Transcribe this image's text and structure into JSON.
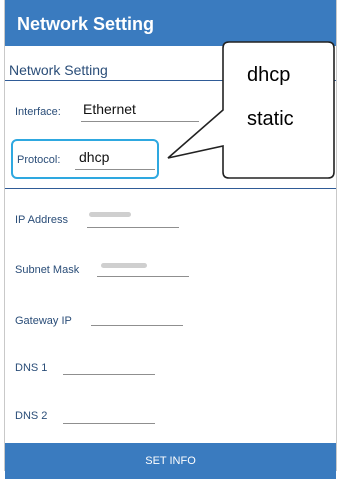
{
  "app": {
    "title": "Network Setting"
  },
  "section": {
    "title": "Network Setting"
  },
  "fields": {
    "interface": {
      "label": "Interface:",
      "value": "Ethernet"
    },
    "protocol": {
      "label": "Protocol:",
      "value": "dhcp"
    },
    "ip_address": {
      "label": "IP Address"
    },
    "subnet_mask": {
      "label": "Subnet Mask"
    },
    "gateway_ip": {
      "label": "Gateway IP"
    },
    "dns1": {
      "label": "DNS 1"
    },
    "dns2": {
      "label": "DNS 2"
    }
  },
  "buttons": {
    "set_info": "SET INFO"
  },
  "dropdown": {
    "options": [
      "dhcp",
      "static"
    ]
  },
  "colors": {
    "accent": "#3a7bbf",
    "highlight": "#2ea8e0",
    "label_text": "#2a4d78"
  }
}
